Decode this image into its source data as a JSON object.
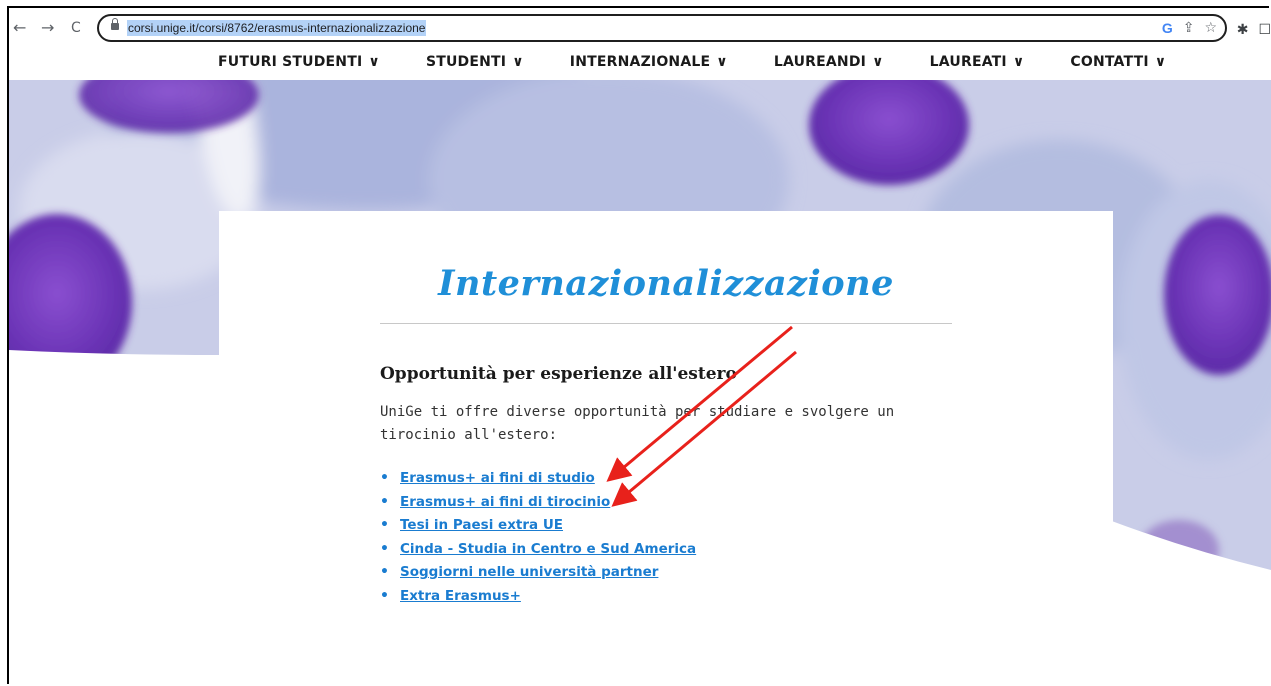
{
  "browser": {
    "back_icon": "←",
    "forward_icon": "→",
    "reload_icon": "C",
    "url": "corsi.unige.it/corsi/8762/erasmus-internazionalizzazione",
    "google_icon": "G",
    "share_icon": "⇪",
    "star_icon": "☆",
    "extensions_icon": "✱",
    "sidepanel_icon": "☐"
  },
  "nav": {
    "items": [
      {
        "label": "FUTURI STUDENTI"
      },
      {
        "label": "STUDENTI"
      },
      {
        "label": "INTERNAZIONALE"
      },
      {
        "label": "LAUREANDI"
      },
      {
        "label": "LAUREATI"
      },
      {
        "label": "CONTATTI"
      }
    ],
    "chevron": "∨"
  },
  "page": {
    "title": "Internazionalizzazione",
    "subtitle": "Opportunità per esperienze all'estero",
    "intro": "UniGe ti offre diverse opportunità per studiare e svolgere un tirocinio all'estero:",
    "links": [
      {
        "label": "Erasmus+ ai fini di studio"
      },
      {
        "label": "Erasmus+ ai fini di tirocinio"
      },
      {
        "label": "Tesi in Paesi extra UE"
      },
      {
        "label": "Cinda - Studia in Centro e Sud America"
      },
      {
        "label": "Soggiorni nelle università partner"
      },
      {
        "label": "Extra Erasmus+"
      }
    ]
  },
  "colors": {
    "title": "#1f8fd8",
    "link": "#1a7cd0",
    "annotation_arrow": "#e8211b",
    "hero_bg": "#c9cde8",
    "hero_cell": "#6b35b8"
  }
}
